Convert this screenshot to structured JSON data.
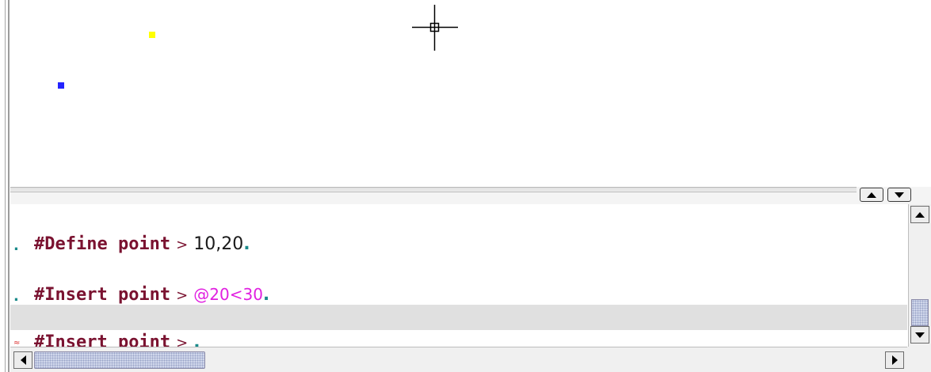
{
  "canvas": {
    "points": [
      {
        "name": "yellow-point",
        "color": "#ffff00"
      },
      {
        "name": "blue-point",
        "color": "#2323ff"
      }
    ],
    "cursor_icon": "crosshair-pickbox-icon"
  },
  "splitter": {
    "up_icon": "triangle-up-icon",
    "down_icon": "triangle-down-icon"
  },
  "command_history": {
    "lines": [
      {
        "prompt": "#Define point",
        "separator": ">",
        "value": "10,20",
        "terminator": "."
      },
      {
        "echo": "."
      },
      {
        "prompt": "#Insert point",
        "separator": ">",
        "value": "@20<30",
        "terminator": "."
      },
      {
        "echo": "."
      },
      {
        "prompt": "#Insert point",
        "separator": ">",
        "value": "",
        "terminator": "."
      }
    ],
    "colors": {
      "keyword": "#7a1230",
      "relative_value": "#e020e0",
      "terminator": "#1a8a8a",
      "active_line_bg": "#e0e0e0"
    }
  },
  "vertical_scrollbar": {
    "up_icon": "arrow-up-icon",
    "down_icon": "arrow-down-icon"
  },
  "horizontal_scrollbar": {
    "left_icon": "arrow-left-icon",
    "right_icon": "arrow-right-icon"
  }
}
